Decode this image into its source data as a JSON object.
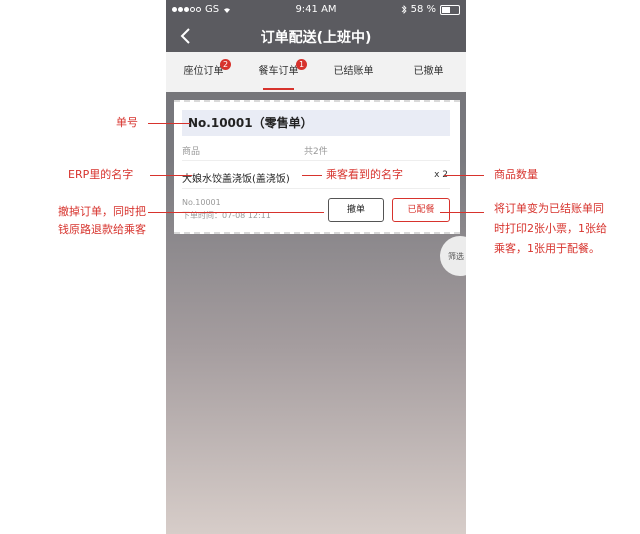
{
  "status_bar": {
    "carrier": "GS",
    "time": "9:41 AM",
    "battery": "58 %",
    "battery_level": 0.58
  },
  "nav": {
    "title": "订单配送(上班中)"
  },
  "tabs": [
    {
      "label": "座位订单",
      "badge": "2"
    },
    {
      "label": "餐车订单",
      "badge": "1",
      "active": true
    },
    {
      "label": "已结账单"
    },
    {
      "label": "已撤单"
    }
  ],
  "order": {
    "number_title": "No.10001（零售单）",
    "col_goods": "商品",
    "col_count": "共2件",
    "item_name": "大娘水饺盖浇饭(盖浇饭)",
    "item_qty": "x 2",
    "order_no": "No.10001",
    "order_time": "下单时间：07-08 12:11",
    "btn_cancel": "撤单",
    "btn_prepared": "已配餐"
  },
  "filter_label": "筛选",
  "annotations": {
    "order_number": "单号",
    "erp_name": "ERP里的名字",
    "cancel_note_1": "撤掉订单，同时把",
    "cancel_note_2": "钱原路退款给乘客",
    "passenger_name": "乘客看到的名字",
    "qty": "商品数量",
    "prepared_note_1": "将订单变为已结账单同",
    "prepared_note_2": "时打印2张小票，1张给",
    "prepared_note_3": "乘客，1张用于配餐。"
  },
  "colors": {
    "accent": "#d7332d",
    "bar": "#5b5b60"
  }
}
